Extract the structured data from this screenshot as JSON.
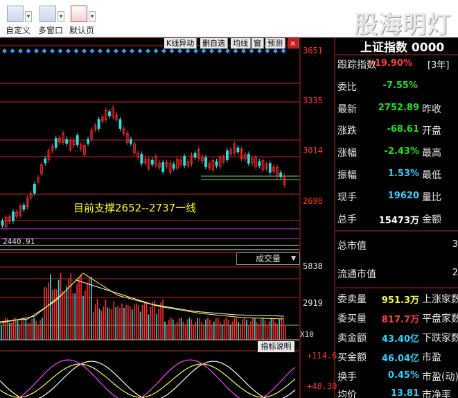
{
  "toolbar": {
    "buttons": [
      {
        "label": "自定义"
      },
      {
        "label": "多窗口"
      },
      {
        "label": "默认页"
      }
    ],
    "brand": "股海明灯"
  },
  "chart_menu": [
    "K线异动",
    "删自选",
    "均线",
    "窗",
    "预测"
  ],
  "price_axis": [
    "3651",
    "3335",
    "3014",
    "2698"
  ],
  "support_text": "目前支撑2652--2737一线",
  "low_label": "2440.91",
  "volume": {
    "header": "成交量",
    "axis": [
      "5838",
      "2919"
    ],
    "unit": "X10"
  },
  "indicator": {
    "button": "指标说明",
    "axis": [
      "+114.6",
      "+48.30"
    ]
  },
  "panel": {
    "title": "上证指数 0000",
    "rows": [
      {
        "label": "跟踪指数",
        "value": "+19.90%",
        "extra": "[3年]",
        "color": "red"
      },
      {
        "label": "委比",
        "value": "-7.55%",
        "extra": "",
        "color": "green"
      },
      {
        "label": "最新",
        "value": "2752.89",
        "extra": "昨收",
        "color": "green"
      },
      {
        "label": "涨跌",
        "value": "-68.61",
        "extra": "开盘",
        "color": "green"
      },
      {
        "label": "涨幅",
        "value": "-2.43%",
        "extra": "最高",
        "color": "green"
      },
      {
        "label": "振幅",
        "value": "1.53%",
        "extra": "最低",
        "color": "cyan"
      },
      {
        "label": "现手",
        "value": "19620",
        "extra": "量比",
        "color": "cyan"
      },
      {
        "label": "总手",
        "value": "15473万",
        "extra": "金额",
        "color": "white"
      }
    ],
    "market": [
      {
        "label": "总市值",
        "value": "3"
      },
      {
        "label": "流通市值",
        "value": "2"
      }
    ],
    "orders": [
      {
        "label": "委卖量",
        "value": "951.3万",
        "extra": "上涨家数",
        "color": "yellow"
      },
      {
        "label": "委买量",
        "value": "817.7万",
        "extra": "平盘家数",
        "color": "red"
      },
      {
        "label": "卖金额",
        "value": "43.40亿",
        "extra": "下跌家数",
        "color": "cyan"
      },
      {
        "label": "买金额",
        "value": "46.04亿",
        "extra": "市盈",
        "color": "cyan"
      },
      {
        "label": "换手",
        "value": "0.45%",
        "extra": "市盈(动)",
        "color": "cyan"
      },
      {
        "label": "均价",
        "value": "13.81",
        "extra": "市净率",
        "color": "cyan"
      }
    ]
  }
}
